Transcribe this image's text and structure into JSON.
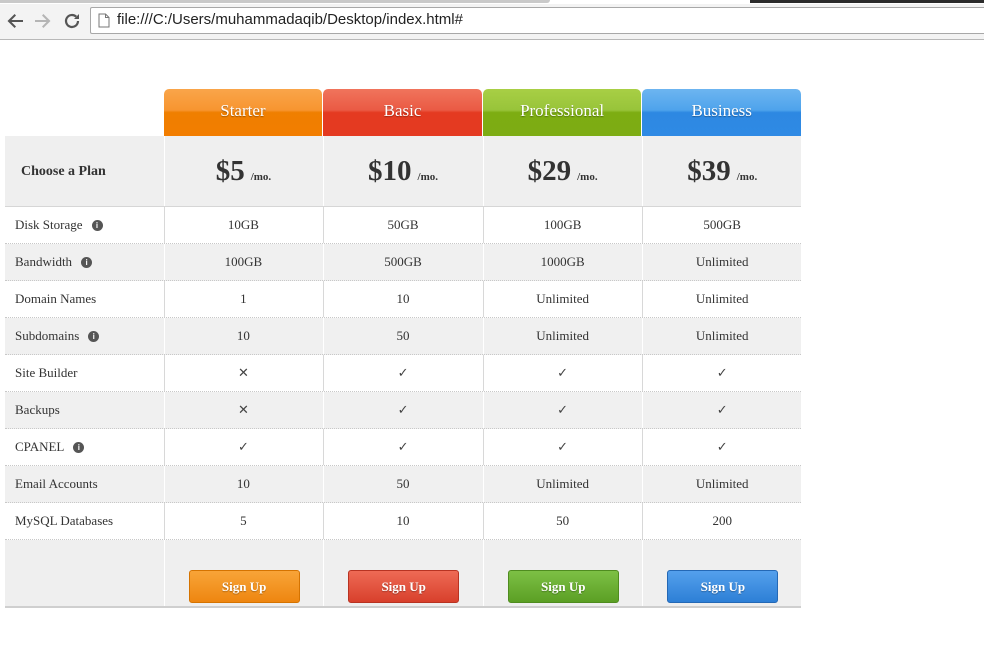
{
  "browser": {
    "url": "file:///C:/Users/muhammadaqib/Desktop/index.html#"
  },
  "pricing": {
    "choose_label": "Choose a Plan",
    "plans": [
      {
        "name": "Starter",
        "price": "$5",
        "unit": "/mo.",
        "color": "#f27d00",
        "signup": "Sign Up"
      },
      {
        "name": "Basic",
        "price": "$10",
        "unit": "/mo.",
        "color": "#e43a21",
        "signup": "Sign Up"
      },
      {
        "name": "Professional",
        "price": "$29",
        "unit": "/mo.",
        "color": "#7dac14",
        "signup": "Sign Up"
      },
      {
        "name": "Business",
        "price": "$39",
        "unit": "/mo.",
        "color": "#2f8ae4",
        "signup": "Sign Up"
      }
    ],
    "features": [
      {
        "label": "Disk Storage",
        "info": true,
        "values": [
          "10GB",
          "50GB",
          "100GB",
          "500GB"
        ]
      },
      {
        "label": "Bandwidth",
        "info": true,
        "values": [
          "100GB",
          "500GB",
          "1000GB",
          "Unlimited"
        ]
      },
      {
        "label": "Domain Names",
        "info": false,
        "values": [
          "1",
          "10",
          "Unlimited",
          "Unlimited"
        ]
      },
      {
        "label": "Subdomains",
        "info": true,
        "values": [
          "10",
          "50",
          "Unlimited",
          "Unlimited"
        ]
      },
      {
        "label": "Site Builder",
        "info": false,
        "values": [
          "✕",
          "✓",
          "✓",
          "✓"
        ]
      },
      {
        "label": "Backups",
        "info": false,
        "values": [
          "✕",
          "✓",
          "✓",
          "✓"
        ]
      },
      {
        "label": "CPANEL",
        "info": true,
        "values": [
          "✓",
          "✓",
          "✓",
          "✓"
        ]
      },
      {
        "label": "Email Accounts",
        "info": false,
        "values": [
          "10",
          "50",
          "Unlimited",
          "Unlimited"
        ]
      },
      {
        "label": "MySQL Databases",
        "info": false,
        "values": [
          "5",
          "10",
          "50",
          "200"
        ]
      }
    ],
    "info_glyph": "i"
  }
}
